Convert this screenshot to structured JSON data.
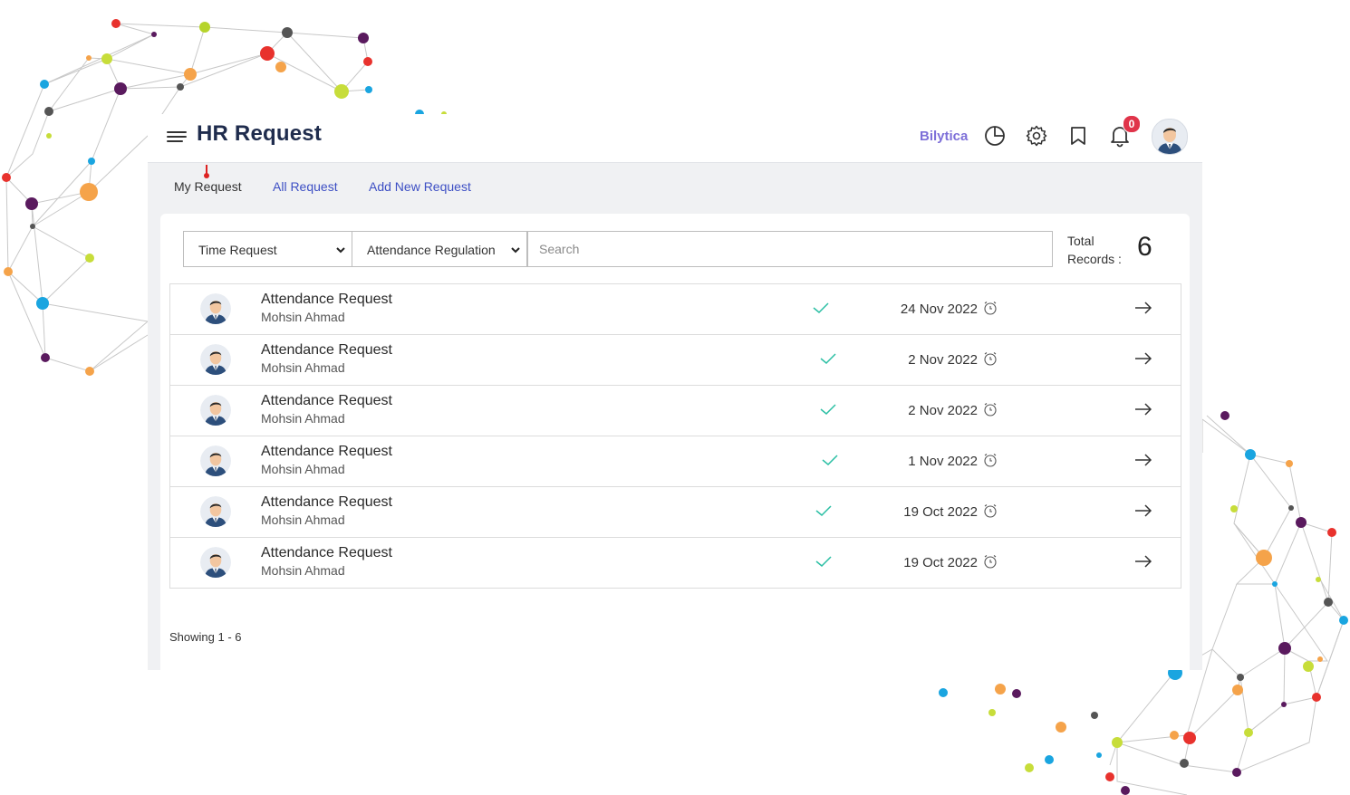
{
  "header": {
    "title": "HR Request",
    "brand": "Bilytica",
    "notification_count": "0"
  },
  "tabs": [
    {
      "label": "My Request",
      "active": true
    },
    {
      "label": "All Request",
      "active": false
    },
    {
      "label": "Add New Request",
      "active": false
    }
  ],
  "filters": {
    "type_select": "Time Request",
    "subtype_select": "Attendance Regulation",
    "search_placeholder": "Search"
  },
  "summary": {
    "total_label_line1": "Total",
    "total_label_line2": "Records :",
    "total_count": "6"
  },
  "requests": [
    {
      "title": "Attendance Request",
      "requester": "Mohsin Ahmad",
      "date": "24 Nov 2022"
    },
    {
      "title": "Attendance Request",
      "requester": "Mohsin Ahmad",
      "date": "2 Nov 2022"
    },
    {
      "title": "Attendance Request",
      "requester": "Mohsin Ahmad",
      "date": "2 Nov 2022"
    },
    {
      "title": "Attendance Request",
      "requester": "Mohsin Ahmad",
      "date": "1 Nov 2022"
    },
    {
      "title": "Attendance Request",
      "requester": "Mohsin Ahmad",
      "date": "19 Oct 2022"
    },
    {
      "title": "Attendance Request",
      "requester": "Mohsin Ahmad",
      "date": "19 Oct 2022"
    }
  ],
  "pagination": {
    "showing": "Showing 1 - 6"
  },
  "colors": {
    "title": "#1f2c4d",
    "brand": "#7d6fd8",
    "link": "#3d4fc4",
    "check": "#2bbfa4",
    "badge": "#e0344a"
  },
  "icons": {
    "menu": "hamburger-icon",
    "chart": "pie-chart-icon",
    "settings": "gear-icon",
    "bookmark": "bookmark-icon",
    "notifications": "bell-icon",
    "row_status": "check-icon",
    "row_time": "alarm-clock-icon",
    "row_open": "arrow-right-icon"
  }
}
